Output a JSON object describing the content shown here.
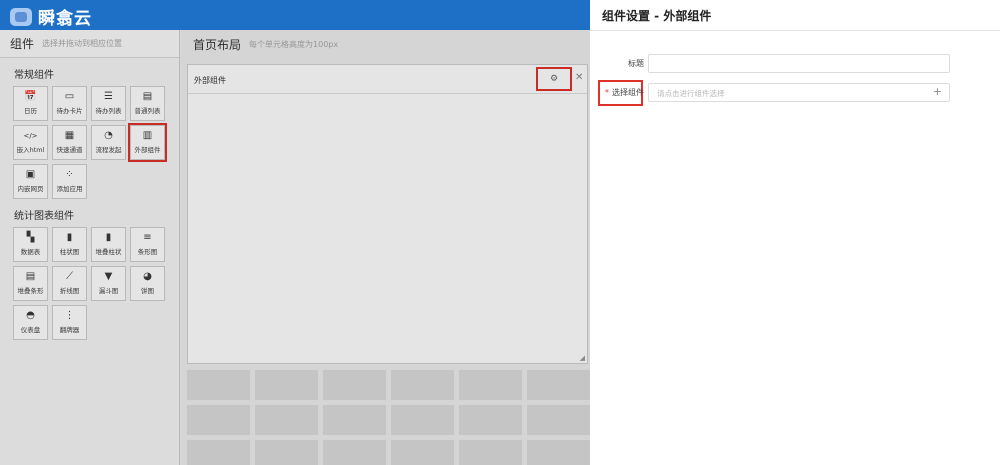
{
  "app": {
    "name": "瞬翕云"
  },
  "left_panel": {
    "title": "组件",
    "hint": "选择并拖动到相应位置",
    "groups": [
      {
        "title": "常规组件",
        "items": [
          {
            "label": "日历",
            "icon": "calendar-icon",
            "glyph": "📅"
          },
          {
            "label": "待办卡片",
            "icon": "card-icon",
            "glyph": "▭"
          },
          {
            "label": "待办列表",
            "icon": "list-icon",
            "glyph": "☰"
          },
          {
            "label": "普通列表",
            "icon": "table-icon",
            "glyph": "▤"
          },
          {
            "label": "嵌入html",
            "icon": "code-icon",
            "glyph": "</>"
          },
          {
            "label": "快速通道",
            "icon": "grid-icon",
            "glyph": "▦"
          },
          {
            "label": "流程发起",
            "icon": "gauge-icon",
            "glyph": "◔"
          },
          {
            "label": "外部组件",
            "icon": "bars-icon",
            "glyph": "▥"
          },
          {
            "label": "内嵌网页",
            "icon": "webpage-icon",
            "glyph": "▣"
          },
          {
            "label": "添加应用",
            "icon": "apps-icon",
            "glyph": "⁘"
          }
        ]
      },
      {
        "title": "统计图表组件",
        "items": [
          {
            "label": "数据表",
            "icon": "datatable-icon",
            "glyph": "▚"
          },
          {
            "label": "柱状图",
            "icon": "bar-chart-icon",
            "glyph": "▮"
          },
          {
            "label": "堆叠柱状",
            "icon": "stacked-bar-icon",
            "glyph": "▮"
          },
          {
            "label": "条形图",
            "icon": "hbar-chart-icon",
            "glyph": "≡"
          },
          {
            "label": "堆叠条形",
            "icon": "stacked-hbar-icon",
            "glyph": "▤"
          },
          {
            "label": "折线图",
            "icon": "line-chart-icon",
            "glyph": "⟋"
          },
          {
            "label": "漏斗图",
            "icon": "funnel-icon",
            "glyph": "▼"
          },
          {
            "label": "饼图",
            "icon": "pie-chart-icon",
            "glyph": "◕"
          },
          {
            "label": "仪表盘",
            "icon": "dashboard-icon",
            "glyph": "◓"
          },
          {
            "label": "翻牌器",
            "icon": "flipper-icon",
            "glyph": "⋮"
          }
        ]
      }
    ]
  },
  "center": {
    "title": "首页布局",
    "hint": "每个单元格高度为100px",
    "card": {
      "title": "外部组件"
    }
  },
  "drawer": {
    "title": "组件设置 - 外部组件",
    "title_label": "标题",
    "title_value": "",
    "select_label": "选择组件",
    "select_placeholder": "请点击进行组件选择"
  },
  "colors": {
    "brand": "#1d70c6",
    "highlight": "#e0302a"
  }
}
